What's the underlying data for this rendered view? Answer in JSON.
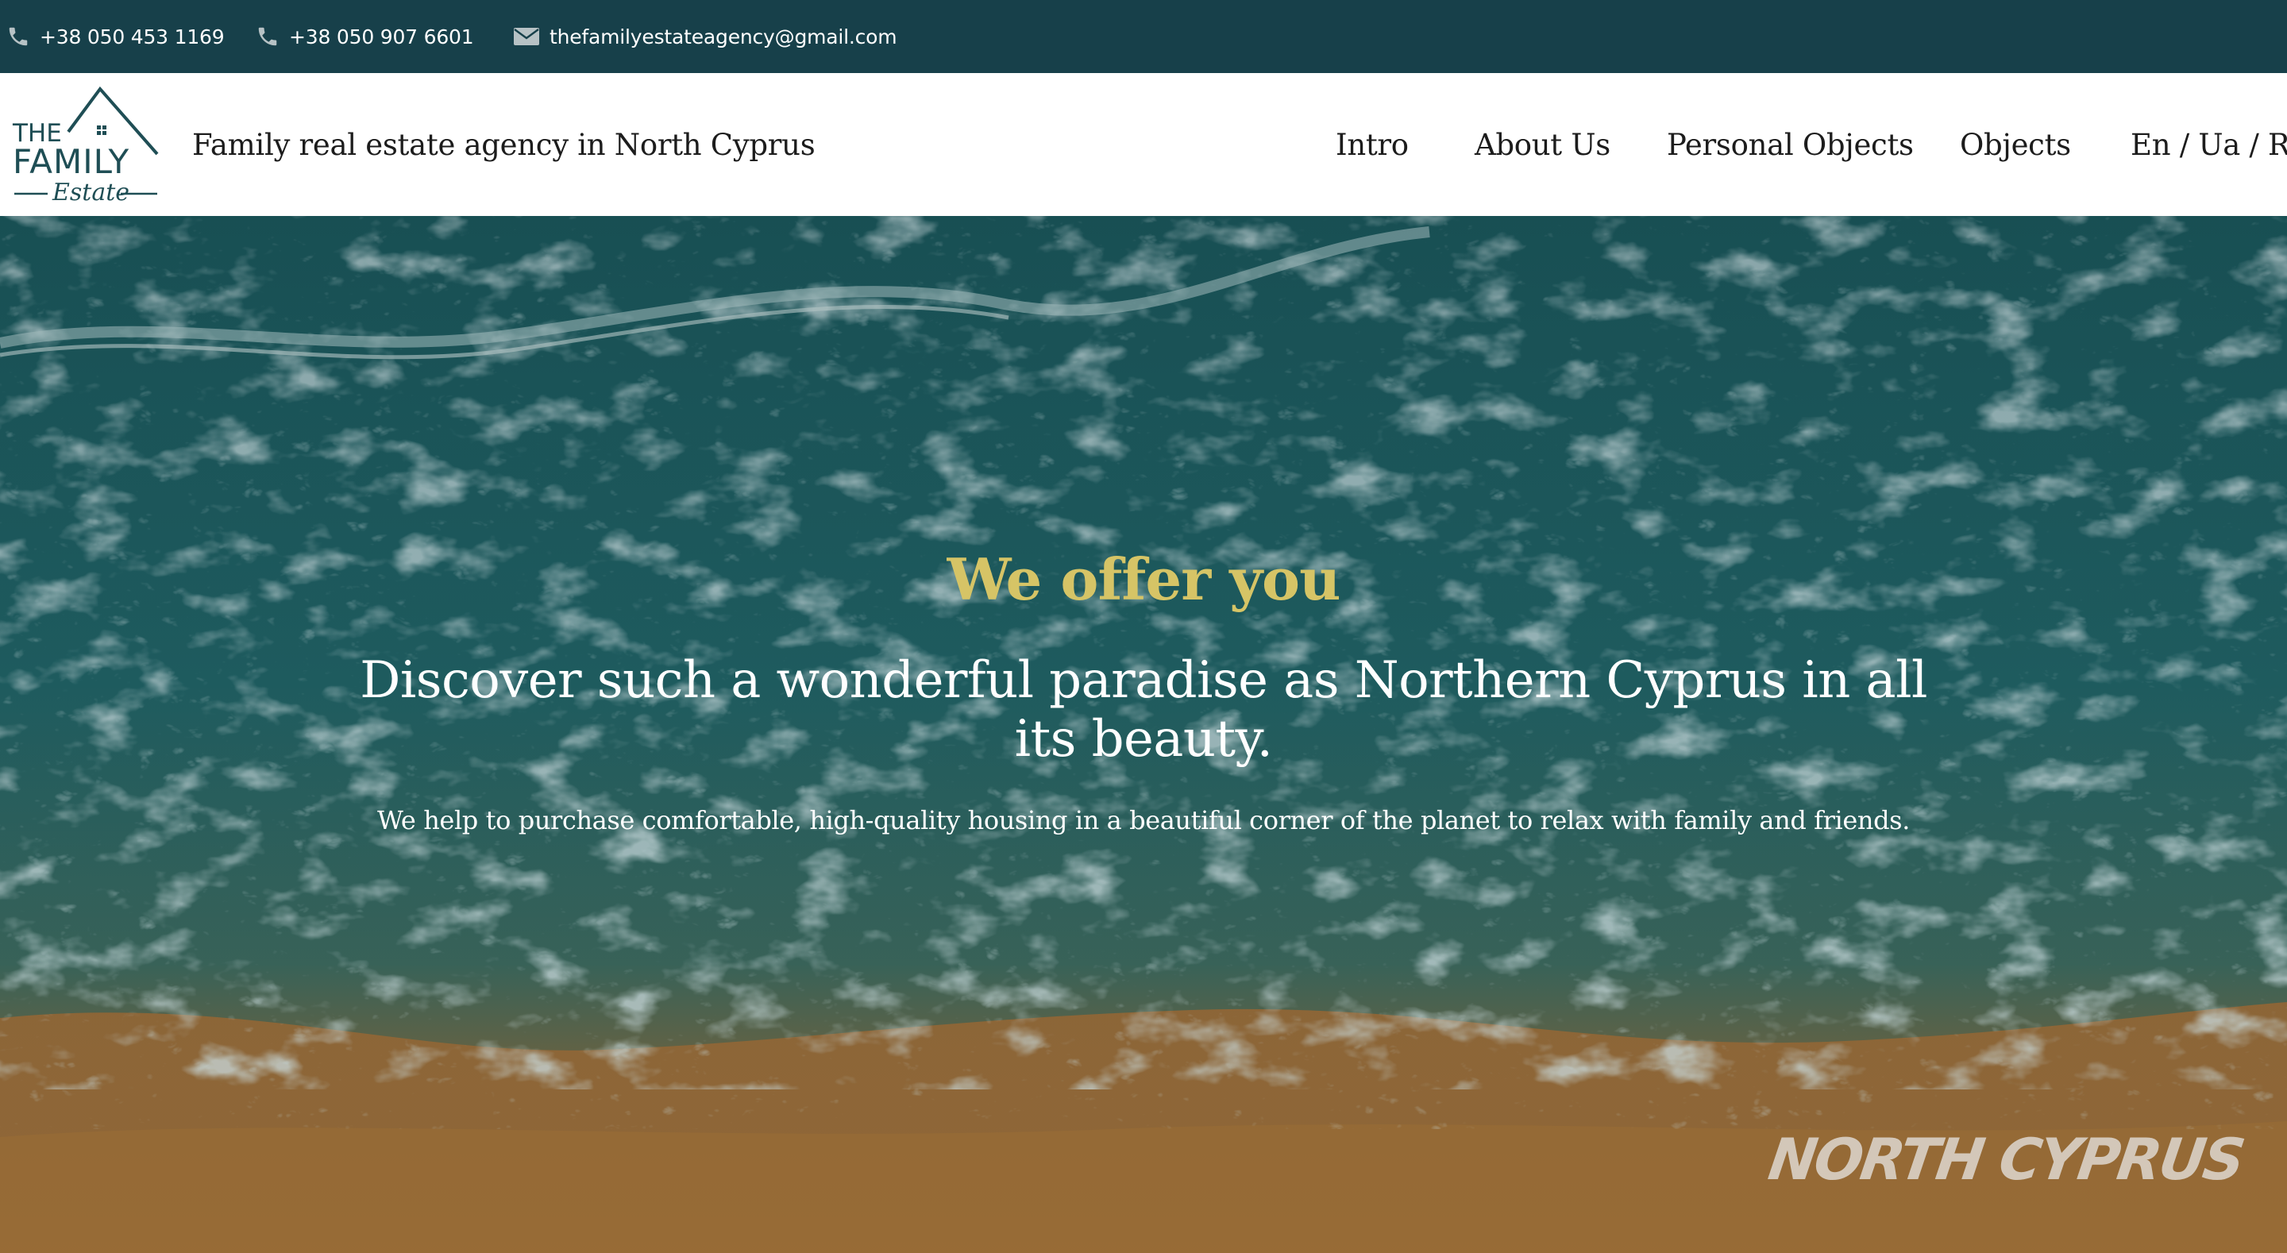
{
  "topbar": {
    "phone_1": "+38 050 453 1169",
    "phone_2": "+38 050 907 6601",
    "email": "thefamilyestateagency@gmail.com",
    "icons": [
      "phone-icon",
      "phone-icon",
      "mail-icon"
    ],
    "background_color": "#17404a"
  },
  "header": {
    "logo": {
      "line_1": "THE",
      "line_2": "FAMILY",
      "line_3": "Estate"
    },
    "tagline": "Family real estate agency in North Cyprus",
    "nav": {
      "intro": "Intro",
      "about": "About Us",
      "personal_objects": "Personal Objects",
      "objects": "Objects",
      "languages": "En / Ua / Ru"
    }
  },
  "hero": {
    "kicker": "We offer you",
    "title": "Discover such a wonderful paradise as Northern Cyprus in all its beauty.",
    "subtitle": "We help to purchase comfortable, high-quality housing in a beautiful corner of the planet to relax with family and friends.",
    "watermark": "NORTH CYPRUS",
    "accent_color": "#d6c466"
  }
}
